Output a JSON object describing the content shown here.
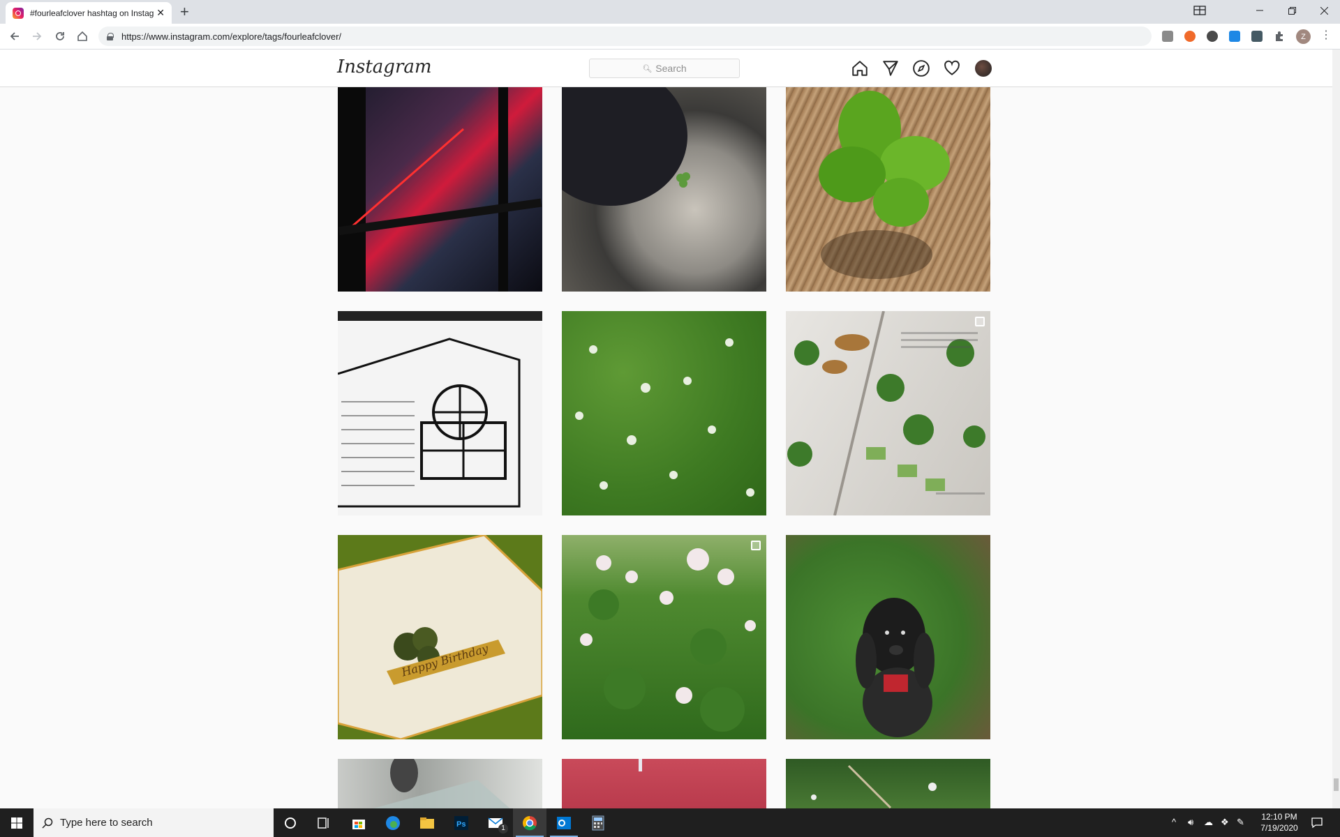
{
  "browser": {
    "tab_title": "#fourleafclover hashtag on Instag",
    "tab_close": "✕",
    "new_tab": "+",
    "url": "https://www.instagram.com/explore/tags/fourleafclover/",
    "profile_initial": "Z"
  },
  "instagram": {
    "logo": "Instagram",
    "search_placeholder": "Search",
    "search_icon": "search-icon",
    "nav_icons": [
      "home-icon",
      "direct-icon",
      "explore-icon",
      "activity-icon",
      "profile-avatar"
    ]
  },
  "posts": [
    {
      "desc": "city window neon",
      "multi": false
    },
    {
      "desc": "mug clover",
      "multi": false
    },
    {
      "desc": "four leaf clover on wood",
      "multi": false
    },
    {
      "desc": "house sketch",
      "multi": false
    },
    {
      "desc": "clover field flowers",
      "multi": false
    },
    {
      "desc": "book with clovers and butterflies",
      "multi": true
    },
    {
      "desc": "happy birthday card",
      "multi": false
    },
    {
      "desc": "white clover flowers",
      "multi": true
    },
    {
      "desc": "dog in clover",
      "multi": false
    },
    {
      "desc": "partial grey",
      "multi": false
    },
    {
      "desc": "partial red",
      "multi": false
    },
    {
      "desc": "partial green",
      "multi": false
    }
  ],
  "card_text": "Happy Birthday",
  "taskbar": {
    "search_placeholder": "Type here to search",
    "time": "12:10 PM",
    "date": "7/19/2020",
    "mail_badge": "1"
  },
  "colors": {
    "accent": "#1a73e8",
    "ig_border": "#dbdbdb"
  }
}
